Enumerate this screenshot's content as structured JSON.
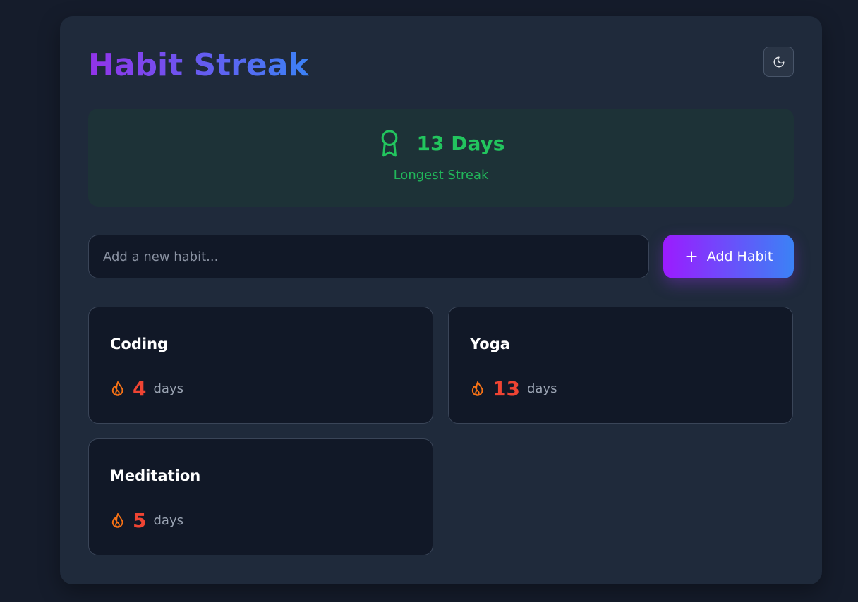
{
  "header": {
    "title": "Habit Streak",
    "theme_toggle_icon": "moon-icon"
  },
  "longest_streak": {
    "icon": "award-icon",
    "value": "13 Days",
    "label": "Longest Streak",
    "color": "#22c55e"
  },
  "new_habit": {
    "placeholder": "Add a new habit...",
    "value": "",
    "button_icon": "plus-icon",
    "button_label": "Add Habit"
  },
  "habits": [
    {
      "name": "Coding",
      "count": "4",
      "unit": "days",
      "icon": "flame-icon"
    },
    {
      "name": "Yoga",
      "count": "13",
      "unit": "days",
      "icon": "flame-icon"
    },
    {
      "name": "Meditation",
      "count": "5",
      "unit": "days",
      "icon": "flame-icon"
    }
  ],
  "colors": {
    "accent_start": "#9333ea",
    "accent_end": "#3b82f6",
    "streak_count": "#ef4433",
    "flame": "#f97316"
  }
}
